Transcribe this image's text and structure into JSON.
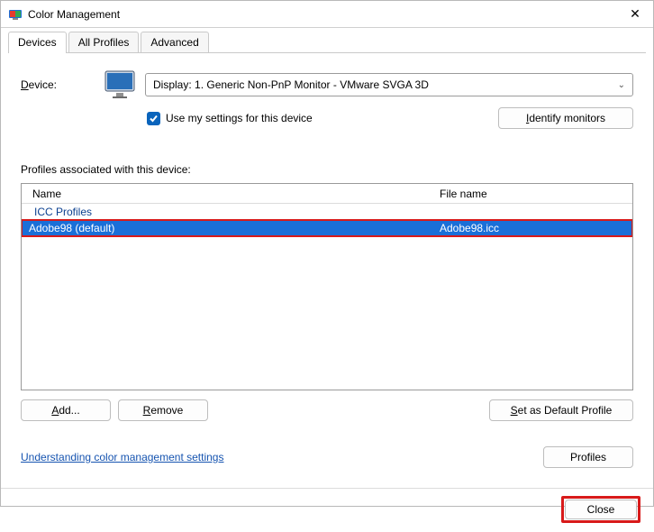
{
  "window": {
    "title": "Color Management"
  },
  "tabs": [
    {
      "label": "Devices",
      "active": true
    },
    {
      "label": "All Profiles"
    },
    {
      "label": "Advanced"
    }
  ],
  "device": {
    "label_pre": "D",
    "label_rest": "evice:",
    "dropdown_value": "Display: 1. Generic Non-PnP Monitor - VMware SVGA 3D",
    "use_settings_pre": "U",
    "use_settings_rest": "se my settings for this device",
    "use_settings_checked": true,
    "identify_pre": "I",
    "identify_rest": "dentify monitors"
  },
  "profiles": {
    "associated_label": "Profiles associated with this device:",
    "columns": {
      "name": "Name",
      "file": "File name"
    },
    "group_header": "ICC Profiles",
    "rows": [
      {
        "name": "Adobe98 (default)",
        "file": "Adobe98.icc",
        "selected": true,
        "highlighted": true
      }
    ]
  },
  "buttons": {
    "add_pre": "A",
    "add_rest": "dd...",
    "remove_pre": "R",
    "remove_rest": "emove",
    "set_default_pre": "S",
    "set_default_rest": "et as Default Profile",
    "profiles": "Profiles",
    "close": "Close"
  },
  "link": {
    "text": "Understanding color management settings"
  }
}
